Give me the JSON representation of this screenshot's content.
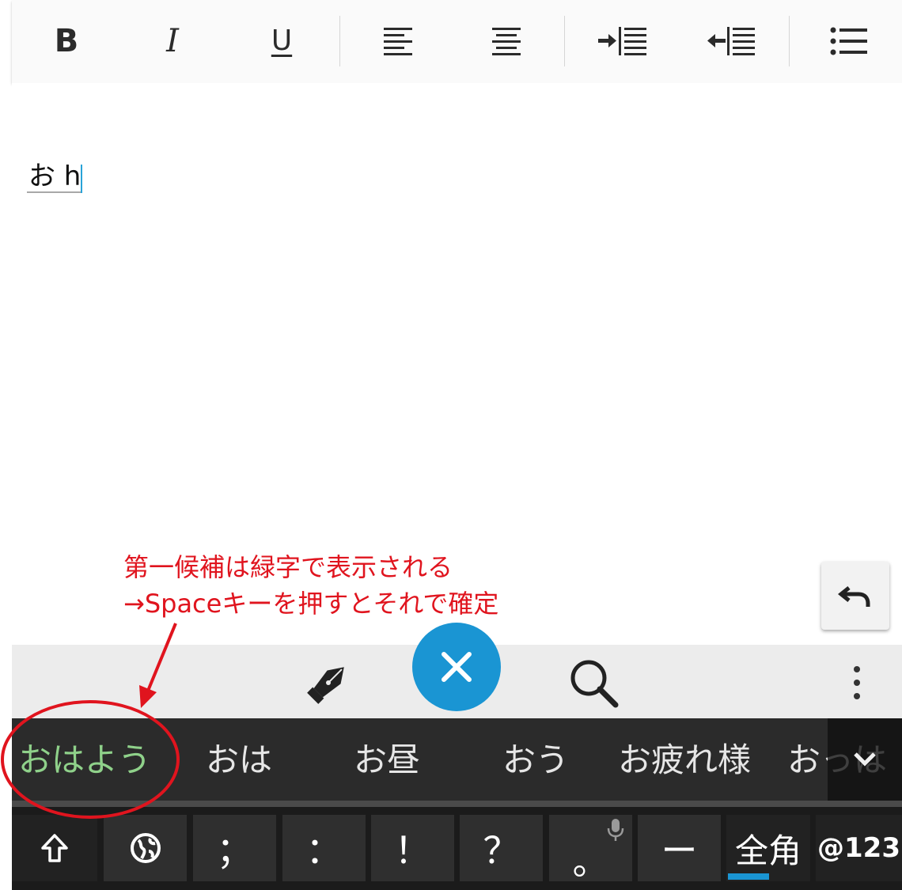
{
  "toolbar": {
    "bold_label": "B",
    "italic_label": "I",
    "underline_label": "U",
    "icons": [
      "bold-icon",
      "italic-icon",
      "underline-icon",
      "align-left-icon",
      "align-center-icon",
      "indent-icon",
      "outdent-icon",
      "bulleted-list-icon"
    ]
  },
  "editor": {
    "composing_text": "お h"
  },
  "annotation": {
    "line1": "第一候補は緑字で表示される",
    "line2": "→Spaceキーを押すとそれで確定",
    "color": "#e0141e"
  },
  "keyboard_toolbar": {
    "icons": [
      "pen-icon",
      "close-icon",
      "search-icon",
      "more-vertical-icon"
    ],
    "close_color": "#1a95d3"
  },
  "candidates": {
    "items": [
      "おはよう",
      "おは",
      "お昼",
      "おう",
      "お疲れ様",
      "おっは"
    ],
    "first_color": "#8fd18a"
  },
  "keyboard": {
    "keys": [
      "⇧",
      "",
      "；",
      "：",
      "！",
      "？",
      "。",
      "ー",
      "全角",
      "@123"
    ]
  }
}
